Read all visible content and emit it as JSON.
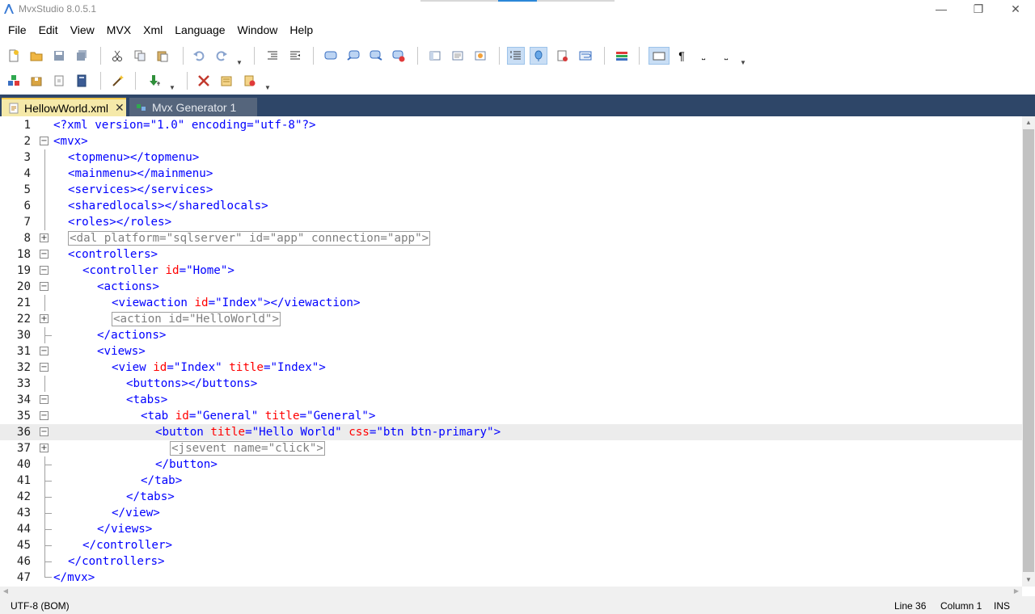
{
  "window": {
    "title": "MvxStudio 8.0.5.1",
    "minimize": "—",
    "restore": "❐",
    "close": "✕"
  },
  "menu": [
    "File",
    "Edit",
    "View",
    "MVX",
    "Xml",
    "Language",
    "Window",
    "Help"
  ],
  "toolbar_row1": [
    "new-file-icon",
    "open-folder-icon",
    "save-icon",
    "save-all-icon",
    "cut-icon",
    "copy-icon",
    "paste-icon",
    "undo-icon",
    "redo-icon",
    "indent-icon",
    "outdent-icon",
    "comment-icon",
    "comment-add-icon",
    "comment-forward-icon",
    "comment-remove-icon",
    "panel-left-icon",
    "panel-text-icon",
    "panel-image-icon",
    "line-numbers-icon",
    "bookmark-icon",
    "document-check-icon",
    "wrap-icon",
    "color-bars-icon",
    "whitespace-box-icon",
    "pilcrow-icon",
    "space-marker-icon",
    "tab-marker-icon"
  ],
  "toolbar_row2": [
    "blocks-icon",
    "package-icon",
    "document-icon",
    "book-icon",
    "magic-wand-icon",
    "download-arrow-icon",
    "tools-icon",
    "edit-list-icon",
    "remove-list-icon"
  ],
  "tabs": [
    {
      "label": "HellowWorld.xml",
      "close": "✕"
    },
    {
      "label": "Mvx Generator 1"
    }
  ],
  "editor": {
    "lines": [
      {
        "n": "1",
        "indent": 0,
        "fold": "",
        "segs": [
          [
            "t",
            "<?xml version=\"1.0\" encoding=\"utf-8\"?>"
          ]
        ]
      },
      {
        "n": "2",
        "indent": 0,
        "fold": "−",
        "segs": [
          [
            "t",
            "<mvx>"
          ]
        ]
      },
      {
        "n": "3",
        "indent": 1,
        "fold": "|",
        "segs": [
          [
            "t",
            "<topmenu></topmenu>"
          ]
        ]
      },
      {
        "n": "4",
        "indent": 1,
        "fold": "|",
        "segs": [
          [
            "t",
            "<mainmenu></mainmenu>"
          ]
        ]
      },
      {
        "n": "5",
        "indent": 1,
        "fold": "|",
        "segs": [
          [
            "t",
            "<services></services>"
          ]
        ]
      },
      {
        "n": "6",
        "indent": 1,
        "fold": "|",
        "segs": [
          [
            "t",
            "<sharedlocals></sharedlocals>"
          ]
        ]
      },
      {
        "n": "7",
        "indent": 1,
        "fold": "|",
        "segs": [
          [
            "t",
            "<roles></roles>"
          ]
        ]
      },
      {
        "n": "8",
        "indent": 1,
        "fold": "+",
        "segs": [
          [
            "c",
            "<dal platform=\"sqlserver\" id=\"app\" connection=\"app\">"
          ]
        ]
      },
      {
        "n": "18",
        "indent": 1,
        "fold": "−",
        "segs": [
          [
            "t",
            "<controllers>"
          ]
        ]
      },
      {
        "n": "19",
        "indent": 2,
        "fold": "−",
        "segs": [
          [
            "t",
            "<controller "
          ],
          [
            "a",
            "id"
          ],
          [
            "t",
            "="
          ],
          [
            "v",
            "\"Home\""
          ],
          [
            "t",
            ">"
          ]
        ]
      },
      {
        "n": "20",
        "indent": 3,
        "fold": "−",
        "segs": [
          [
            "t",
            "<actions>"
          ]
        ]
      },
      {
        "n": "21",
        "indent": 4,
        "fold": "|",
        "segs": [
          [
            "t",
            "<viewaction "
          ],
          [
            "a",
            "id"
          ],
          [
            "t",
            "="
          ],
          [
            "v",
            "\"Index\""
          ],
          [
            "t",
            "></viewaction>"
          ]
        ]
      },
      {
        "n": "22",
        "indent": 4,
        "fold": "+",
        "segs": [
          [
            "c",
            "<action id=\"HelloWorld\">"
          ]
        ]
      },
      {
        "n": "30",
        "indent": 3,
        "fold": "L",
        "segs": [
          [
            "t",
            "</actions>"
          ]
        ]
      },
      {
        "n": "31",
        "indent": 3,
        "fold": "−",
        "segs": [
          [
            "t",
            "<views>"
          ]
        ]
      },
      {
        "n": "32",
        "indent": 4,
        "fold": "−",
        "segs": [
          [
            "t",
            "<view "
          ],
          [
            "a",
            "id"
          ],
          [
            "t",
            "="
          ],
          [
            "v",
            "\"Index\""
          ],
          [
            "t",
            " "
          ],
          [
            "a",
            "title"
          ],
          [
            "t",
            "="
          ],
          [
            "v",
            "\"Index\""
          ],
          [
            "t",
            ">"
          ]
        ]
      },
      {
        "n": "33",
        "indent": 5,
        "fold": "|",
        "segs": [
          [
            "t",
            "<buttons></buttons>"
          ]
        ]
      },
      {
        "n": "34",
        "indent": 5,
        "fold": "−",
        "segs": [
          [
            "t",
            "<tabs>"
          ]
        ]
      },
      {
        "n": "35",
        "indent": 6,
        "fold": "−",
        "segs": [
          [
            "t",
            "<tab "
          ],
          [
            "a",
            "id"
          ],
          [
            "t",
            "="
          ],
          [
            "v",
            "\"General\""
          ],
          [
            "t",
            " "
          ],
          [
            "a",
            "title"
          ],
          [
            "t",
            "="
          ],
          [
            "v",
            "\"General\""
          ],
          [
            "t",
            ">"
          ]
        ]
      },
      {
        "n": "36",
        "indent": 7,
        "fold": "−",
        "segs": [
          [
            "t",
            "<button "
          ],
          [
            "a",
            "title"
          ],
          [
            "t",
            "="
          ],
          [
            "v",
            "\"Hello World\""
          ],
          [
            "t",
            " "
          ],
          [
            "a",
            "css"
          ],
          [
            "t",
            "="
          ],
          [
            "v",
            "\"btn btn-primary\""
          ],
          [
            "t",
            ">"
          ]
        ]
      },
      {
        "n": "37",
        "indent": 8,
        "fold": "+",
        "segs": [
          [
            "c",
            "<jsevent name=\"click\">"
          ]
        ]
      },
      {
        "n": "40",
        "indent": 7,
        "fold": "L",
        "segs": [
          [
            "t",
            "</button>"
          ]
        ]
      },
      {
        "n": "41",
        "indent": 6,
        "fold": "L",
        "segs": [
          [
            "t",
            "</tab>"
          ]
        ]
      },
      {
        "n": "42",
        "indent": 5,
        "fold": "L",
        "segs": [
          [
            "t",
            "</tabs>"
          ]
        ]
      },
      {
        "n": "43",
        "indent": 4,
        "fold": "L",
        "segs": [
          [
            "t",
            "</view>"
          ]
        ]
      },
      {
        "n": "44",
        "indent": 3,
        "fold": "L",
        "segs": [
          [
            "t",
            "</views>"
          ]
        ]
      },
      {
        "n": "45",
        "indent": 2,
        "fold": "L",
        "segs": [
          [
            "t",
            "</controller>"
          ]
        ]
      },
      {
        "n": "46",
        "indent": 1,
        "fold": "L",
        "segs": [
          [
            "t",
            "</controllers>"
          ]
        ]
      },
      {
        "n": "47",
        "indent": 0,
        "fold": "E",
        "segs": [
          [
            "t",
            "</mvx>"
          ]
        ]
      }
    ],
    "current_line": "36"
  },
  "status": {
    "encoding": "UTF-8 (BOM)",
    "line": "Line 36",
    "column": "Column 1",
    "mode": "INS"
  },
  "colors": {
    "tag": "#0000ff",
    "attr": "#ff0000",
    "tabstrip": "#2e4668",
    "active_tab": "#f5e9a9"
  }
}
